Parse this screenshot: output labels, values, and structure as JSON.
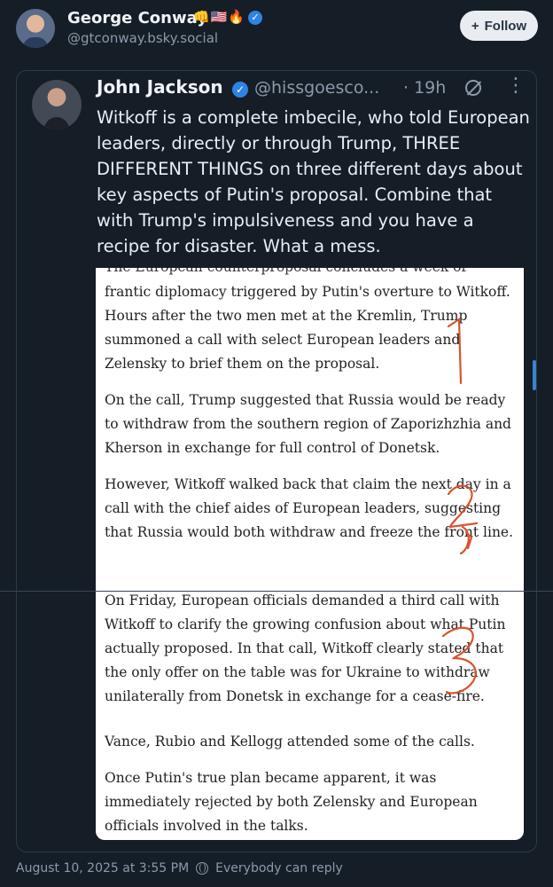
{
  "post": {
    "author_name": "George Conway",
    "author_emojis": [
      "👊",
      "🇺🇸",
      "🔥"
    ],
    "author_handle": "@gtconway.bsky.social",
    "follow_label": "Follow",
    "timestamp": "August 10, 2025 at 3:55 PM",
    "reply_setting": "Everybody can reply"
  },
  "quoted": {
    "author_name": "John Jackson",
    "author_handle": "@hissgoesco...",
    "time": "· 19h",
    "text": "Witkoff is a complete imbecile, who told European leaders, directly or through Trump, THREE DIFFERENT THINGS on three different days about key aspects of Putin's proposal. Combine that with Trump's impulsiveness and you have a recipe for disaster. What a mess.",
    "image": {
      "partial_top": "The European counterproposal concludes a week of",
      "paragraphs": [
        "frantic diplomacy triggered by Putin's overture to Witkoff. Hours after the two men met at the Kremlin, Trump summoned a call with select European leaders and Zelensky to brief them on the proposal.",
        "On the call, Trump suggested that Russia would be ready to withdraw from the southern region of Zaporizhzhia and Kherson in exchange for full control of Donetsk.",
        "However, Witkoff walked back that claim the next day in a call with the chief aides of European leaders, suggesting that Russia would both withdraw and freeze the front line.",
        "On Friday, European officials demanded a third call with Witkoff to clarify the growing confusion about what Putin actually proposed. In that call, Witkoff clearly stated that the only offer on the table was for Ukraine to withdraw unilaterally from Donetsk in exchange for a cease-fire.",
        "Vance, Rubio and Kellogg attended some of the calls.",
        "Once Putin's true plan became apparent, it was immediately rejected by both Zelensky and European officials involved in the talks."
      ],
      "annotations": [
        "1",
        "2",
        "3"
      ],
      "annotation_color": "#d9532c"
    }
  },
  "colors": {
    "background": "#151d27",
    "accent": "#2f83e4",
    "muted": "#8c9aab"
  }
}
